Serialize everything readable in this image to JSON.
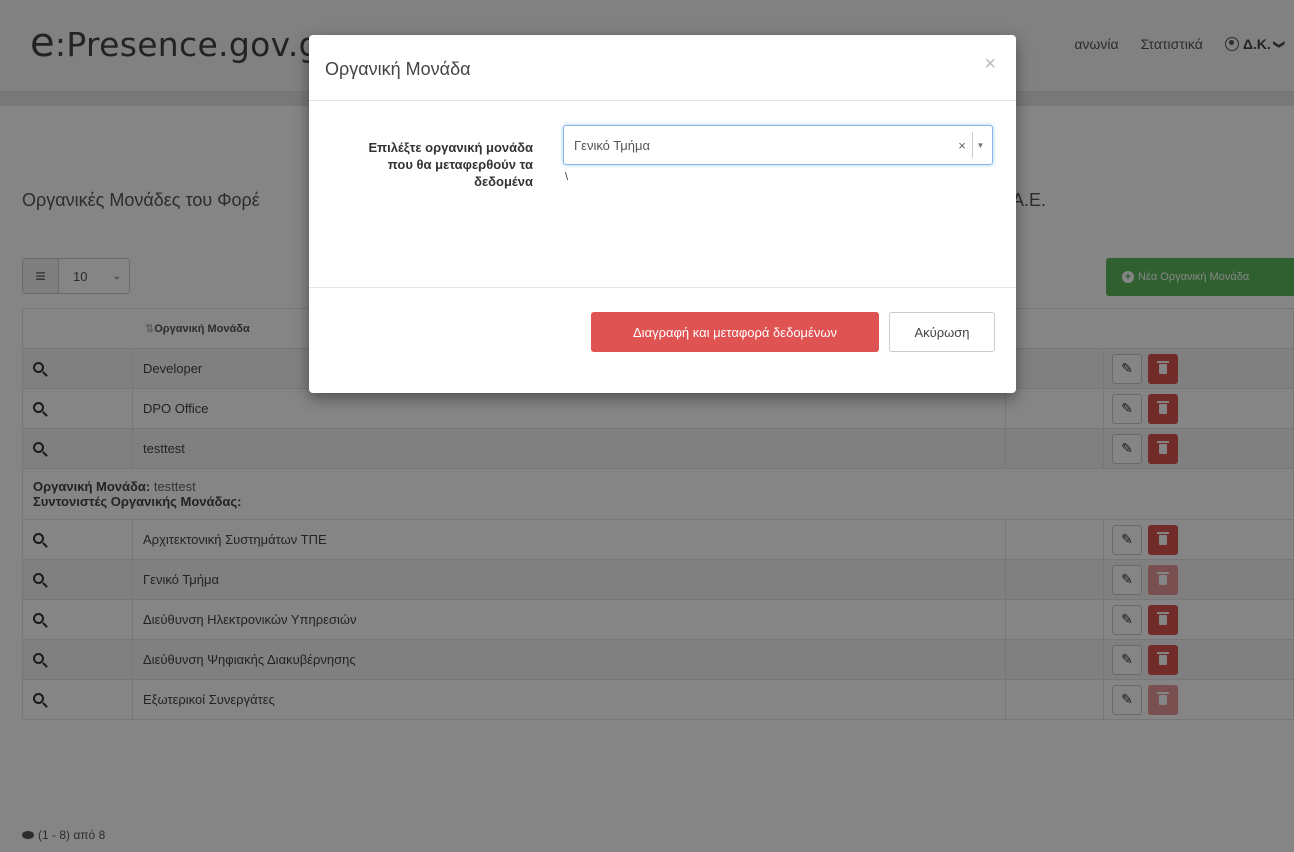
{
  "navbar": {
    "brand": "e:Presence.gov.gr",
    "brand_prefix": "e",
    "brand_rest": ":Presence.gov.gr",
    "items": [
      {
        "label": "ανωνία"
      },
      {
        "label": "Στατιστικά"
      }
    ],
    "user_label": "Δ.Κ.",
    "user_icon": "user-circle-icon",
    "user_caret": "❯"
  },
  "page": {
    "title_left": "Οργανικές Μονάδες του Φορέ",
    "title_right": "Α.Ε.",
    "page_length": "10",
    "new_button_label": "Νέα Οργανική Μονάδα"
  },
  "table": {
    "header": "Οργανική Μονάδα",
    "rows_top": [
      {
        "name": "Developer",
        "delete_enabled": true
      },
      {
        "name": "DPO Office",
        "delete_enabled": true
      },
      {
        "name": "testtest",
        "delete_enabled": true
      }
    ],
    "detail": {
      "unit_label": "Οργανική Μονάδα:",
      "unit_value": "testtest",
      "coordinators_label": "Συντονιστές Οργανικής Μονάδας:"
    },
    "rows_bottom": [
      {
        "name": "Αρχιτεκτονική Συστημάτων ΤΠΕ",
        "delete_enabled": true
      },
      {
        "name": "Γενικό Τμήμα",
        "delete_enabled": false
      },
      {
        "name": "Διεύθυνση Ηλεκτρονικών Υπηρεσιών",
        "delete_enabled": true
      },
      {
        "name": "Διεύθυνση Ψηφιακής Διακυβέρνησης",
        "delete_enabled": true
      },
      {
        "name": "Εξωτερικοί Συνεργάτες",
        "delete_enabled": false
      }
    ]
  },
  "footer": {
    "info": "(1 - 8) από 8"
  },
  "modal": {
    "title": "Οργανική Μονάδα",
    "close": "×",
    "label": "Επιλέξτε οργανική μονάδα που θα μεταφερθούν τα δεδομένα",
    "selected": "Γενικό Τμήμα",
    "clear": "×",
    "stray": "\\",
    "delete_button": "Διαγραφή και μεταφορά δεδομένων",
    "cancel_button": "Ακύρωση"
  },
  "colors": {
    "danger": "#d9534f",
    "success": "#5cb85c",
    "overlay": "rgba(0,0,0,0.48)"
  }
}
